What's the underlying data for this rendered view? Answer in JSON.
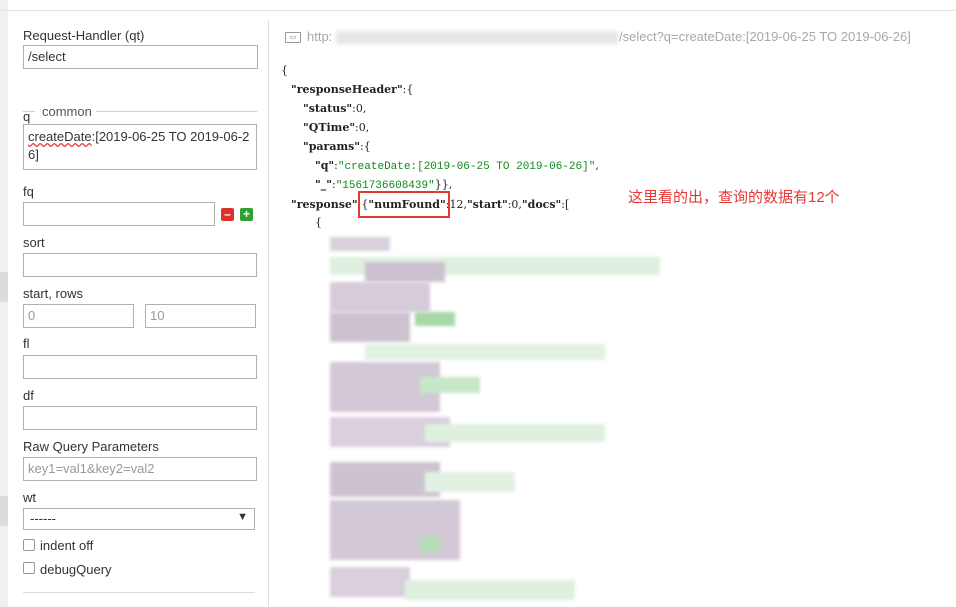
{
  "form": {
    "request_handler_label": "Request-Handler (qt)",
    "request_handler_value": "/select",
    "common_legend": "common",
    "q_label": "q",
    "q_value_field": "createDate",
    "q_value_rest": ":[2019-06-25 TO 2019-06-26]",
    "fq_label": "fq",
    "fq_value": "",
    "sort_label": "sort",
    "sort_value": "",
    "start_rows_label": "start, rows",
    "start_placeholder": "0",
    "rows_placeholder": "10",
    "fl_label": "fl",
    "fl_value": "",
    "df_label": "df",
    "df_value": "",
    "raw_params_label": "Raw Query Parameters",
    "raw_params_placeholder": "key1=val1&key2=val2",
    "wt_label": "wt",
    "wt_value": "------",
    "indent_label": "indent off",
    "debug_label": "debugQuery",
    "remove_icon": "minus-icon",
    "add_icon": "plus-icon"
  },
  "result": {
    "url_scheme": "http:",
    "url_path": "/select?q=createDate:[2019-06-25 TO 2019-06-26]",
    "brace_open": "{",
    "response_header_key": "\"responseHeader\"",
    "status_key": "\"status\"",
    "status_value": "0",
    "qtime_key": "\"QTime\"",
    "qtime_value": "0",
    "params_key": "\"params\"",
    "q_key": "\"q\"",
    "q_string": "\"createDate:[2019-06-25 TO 2019-06-26]\"",
    "underscore_key": "\"_\"",
    "underscore_value": "\"1561736608439\"",
    "response_key": "\"response\"",
    "numfound_key": "\"numFound\"",
    "numfound_value": "12",
    "start_key": "\"start\"",
    "start_value": "0",
    "docs_key": "\"docs\"",
    "doc_brace": "{"
  },
  "annotation": {
    "text": "这里看的出，查询的数据有12个",
    "color": "#e53935"
  }
}
